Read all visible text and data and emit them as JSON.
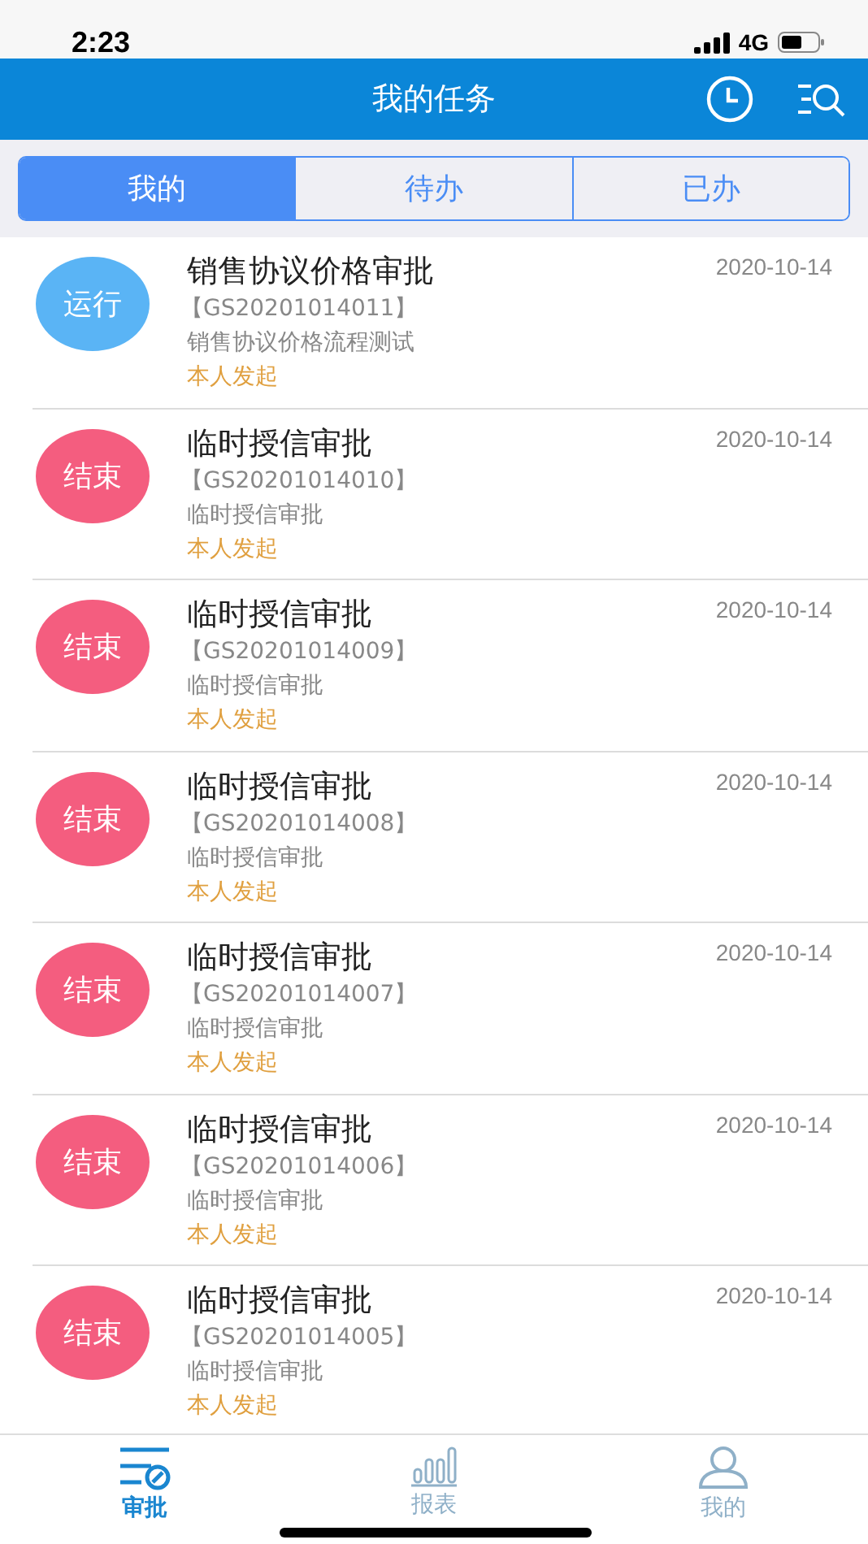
{
  "status_bar": {
    "time": "2:23",
    "network": "4G"
  },
  "header": {
    "title": "我的任务"
  },
  "tabs": [
    {
      "label": "我的",
      "selected": true
    },
    {
      "label": "待办",
      "selected": false
    },
    {
      "label": "已办",
      "selected": false
    }
  ],
  "tasks": [
    {
      "status": "运行",
      "color": "#5ab4f5",
      "title": "销售协议价格审批",
      "code": "【GS20201014011】",
      "description": "销售协议价格流程测试",
      "origin": "本人发起",
      "date": "2020-10-14"
    },
    {
      "status": "结束",
      "color": "#f45d7f",
      "title": "临时授信审批",
      "code": "【GS20201014010】",
      "description": "临时授信审批",
      "origin": "本人发起",
      "date": "2020-10-14"
    },
    {
      "status": "结束",
      "color": "#f45d7f",
      "title": "临时授信审批",
      "code": "【GS20201014009】",
      "description": "临时授信审批",
      "origin": "本人发起",
      "date": "2020-10-14"
    },
    {
      "status": "结束",
      "color": "#f45d7f",
      "title": "临时授信审批",
      "code": "【GS20201014008】",
      "description": "临时授信审批",
      "origin": "本人发起",
      "date": "2020-10-14"
    },
    {
      "status": "结束",
      "color": "#f45d7f",
      "title": "临时授信审批",
      "code": "【GS20201014007】",
      "description": "临时授信审批",
      "origin": "本人发起",
      "date": "2020-10-14"
    },
    {
      "status": "结束",
      "color": "#f45d7f",
      "title": "临时授信审批",
      "code": "【GS20201014006】",
      "description": "临时授信审批",
      "origin": "本人发起",
      "date": "2020-10-14"
    },
    {
      "status": "结束",
      "color": "#f45d7f",
      "title": "临时授信审批",
      "code": "【GS20201014005】",
      "description": "临时授信审批",
      "origin": "本人发起",
      "date": "2020-10-14"
    }
  ],
  "bottom_nav": [
    {
      "kind": "approve",
      "label": "审批",
      "selected": true
    },
    {
      "kind": "report",
      "label": "报表",
      "selected": false
    },
    {
      "kind": "profile",
      "label": "我的",
      "selected": false
    }
  ]
}
